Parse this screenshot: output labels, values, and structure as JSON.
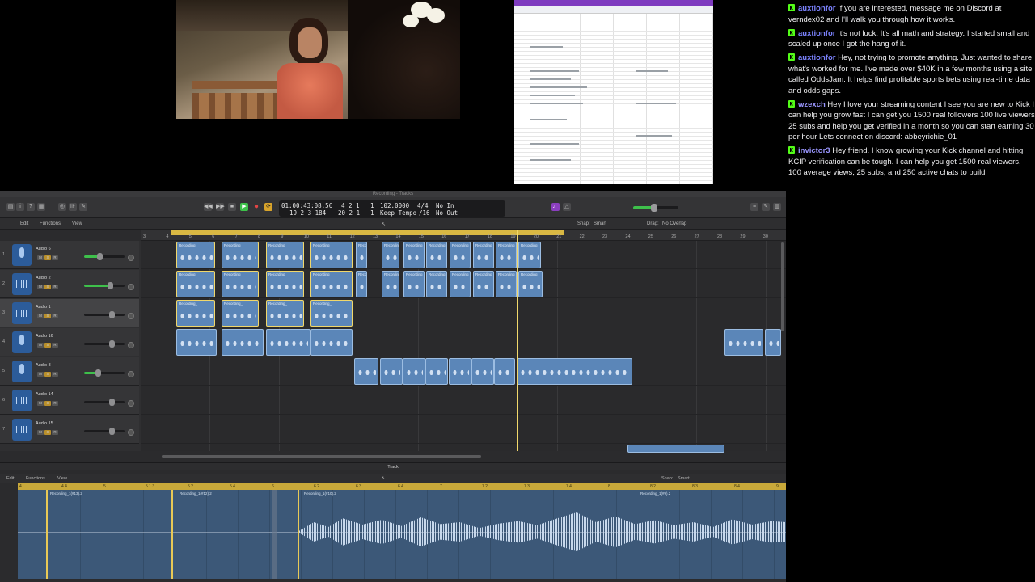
{
  "chat": {
    "messages": [
      {
        "user": "auxtionfor",
        "color": "#6e7bff",
        "text": " If you are interested, message me on Discord at verndex02 and I'll walk you through how it works."
      },
      {
        "user": "auxtionfor",
        "color": "#6e7bff",
        "text": " It's not luck. It's all math and strategy. I started small and scaled up once I got the hang of it."
      },
      {
        "user": "auxtionfor",
        "color": "#6e7bff",
        "text": " Hey, not trying to promote anything. Just wanted to share what's worked for me. I've made over $40K in a few months using a site called OddsJam. It helps find profitable sports bets using real-time data and odds gaps."
      },
      {
        "user": "wzexch",
        "color": "#8f8cff",
        "text": " Hey I love your streaming content I see you are new to Kick I can help you grow fast I can get you 1500 real followers 100 live viewers 25 subs and help you get verified in a month so you can start earning 30 per hour Lets connect on discord: abbeyrichie_01"
      },
      {
        "user": "invictor3",
        "color": "#8f8cff",
        "text": " Hey friend. I know growing your Kick channel and hitting KCIP verification can be tough. I can help you get 1500 real viewers, 100 average views, 25 subs, and 250 active chats to build"
      }
    ]
  },
  "daw": {
    "title": "Recording - Tracks",
    "lcd": {
      "time": "01:00:43:08.56",
      "bars": "19  2  3  184",
      "pos1": "4  2  1",
      "pos2": "20  2  1",
      "one1": "1",
      "one2": "1",
      "tempo": "102.0000",
      "tempo_label": "Keep Tempo",
      "sig": "4/4",
      "div": "/16",
      "in": "No In",
      "out": "No Out"
    },
    "menus": [
      "Edit",
      "Functions",
      "View"
    ],
    "snap_label": "Snap:",
    "snap_value": "Smart",
    "drag_label": "Drag:",
    "drag_value": "No Overlap",
    "bars": [
      "3",
      "4",
      "5",
      "6",
      "7",
      "8",
      "9",
      "10",
      "11",
      "12",
      "13",
      "14",
      "15",
      "16",
      "17",
      "18",
      "19",
      "20",
      "21",
      "22",
      "23",
      "24",
      "25",
      "26",
      "27",
      "28",
      "29",
      "30"
    ],
    "tracks": [
      {
        "num": "1",
        "name": "Audio 6",
        "icon": "mic",
        "level": 40
      },
      {
        "num": "2",
        "name": "Audio 2",
        "icon": "wave",
        "level": 65
      },
      {
        "num": "3",
        "name": "Audio 1",
        "icon": "wave",
        "level": 0
      },
      {
        "num": "4",
        "name": "Audio 16",
        "icon": "mic",
        "level": 0
      },
      {
        "num": "5",
        "name": "Audio 8",
        "icon": "mic",
        "level": 35
      },
      {
        "num": "6",
        "name": "Audio 14",
        "icon": "wave",
        "level": 0
      },
      {
        "num": "7",
        "name": "Audio 15",
        "icon": "wave",
        "level": 0
      }
    ],
    "track_buttons": {
      "mute": "M",
      "solo": "S",
      "rec": "R"
    },
    "region_label": "Recording_",
    "editor": {
      "panel_label": "Track",
      "menus": [
        "Edit",
        "Functions",
        "View"
      ],
      "snap_label": "Snap:",
      "snap_value": "Smart",
      "ruler": [
        "4",
        "4 4",
        "5",
        "5 1 3",
        "5 2",
        "5 4",
        "6",
        "6 2",
        "6 3",
        "6 4",
        "7",
        "7 2",
        "7 3",
        "7 4",
        "8",
        "8 2",
        "8 3",
        "8 4",
        "9"
      ],
      "regions": [
        "Recording_1(#13).2",
        "Recording_1(#12).2",
        "Recording_1(#10).2",
        "Recording_1(#9).2"
      ]
    }
  }
}
